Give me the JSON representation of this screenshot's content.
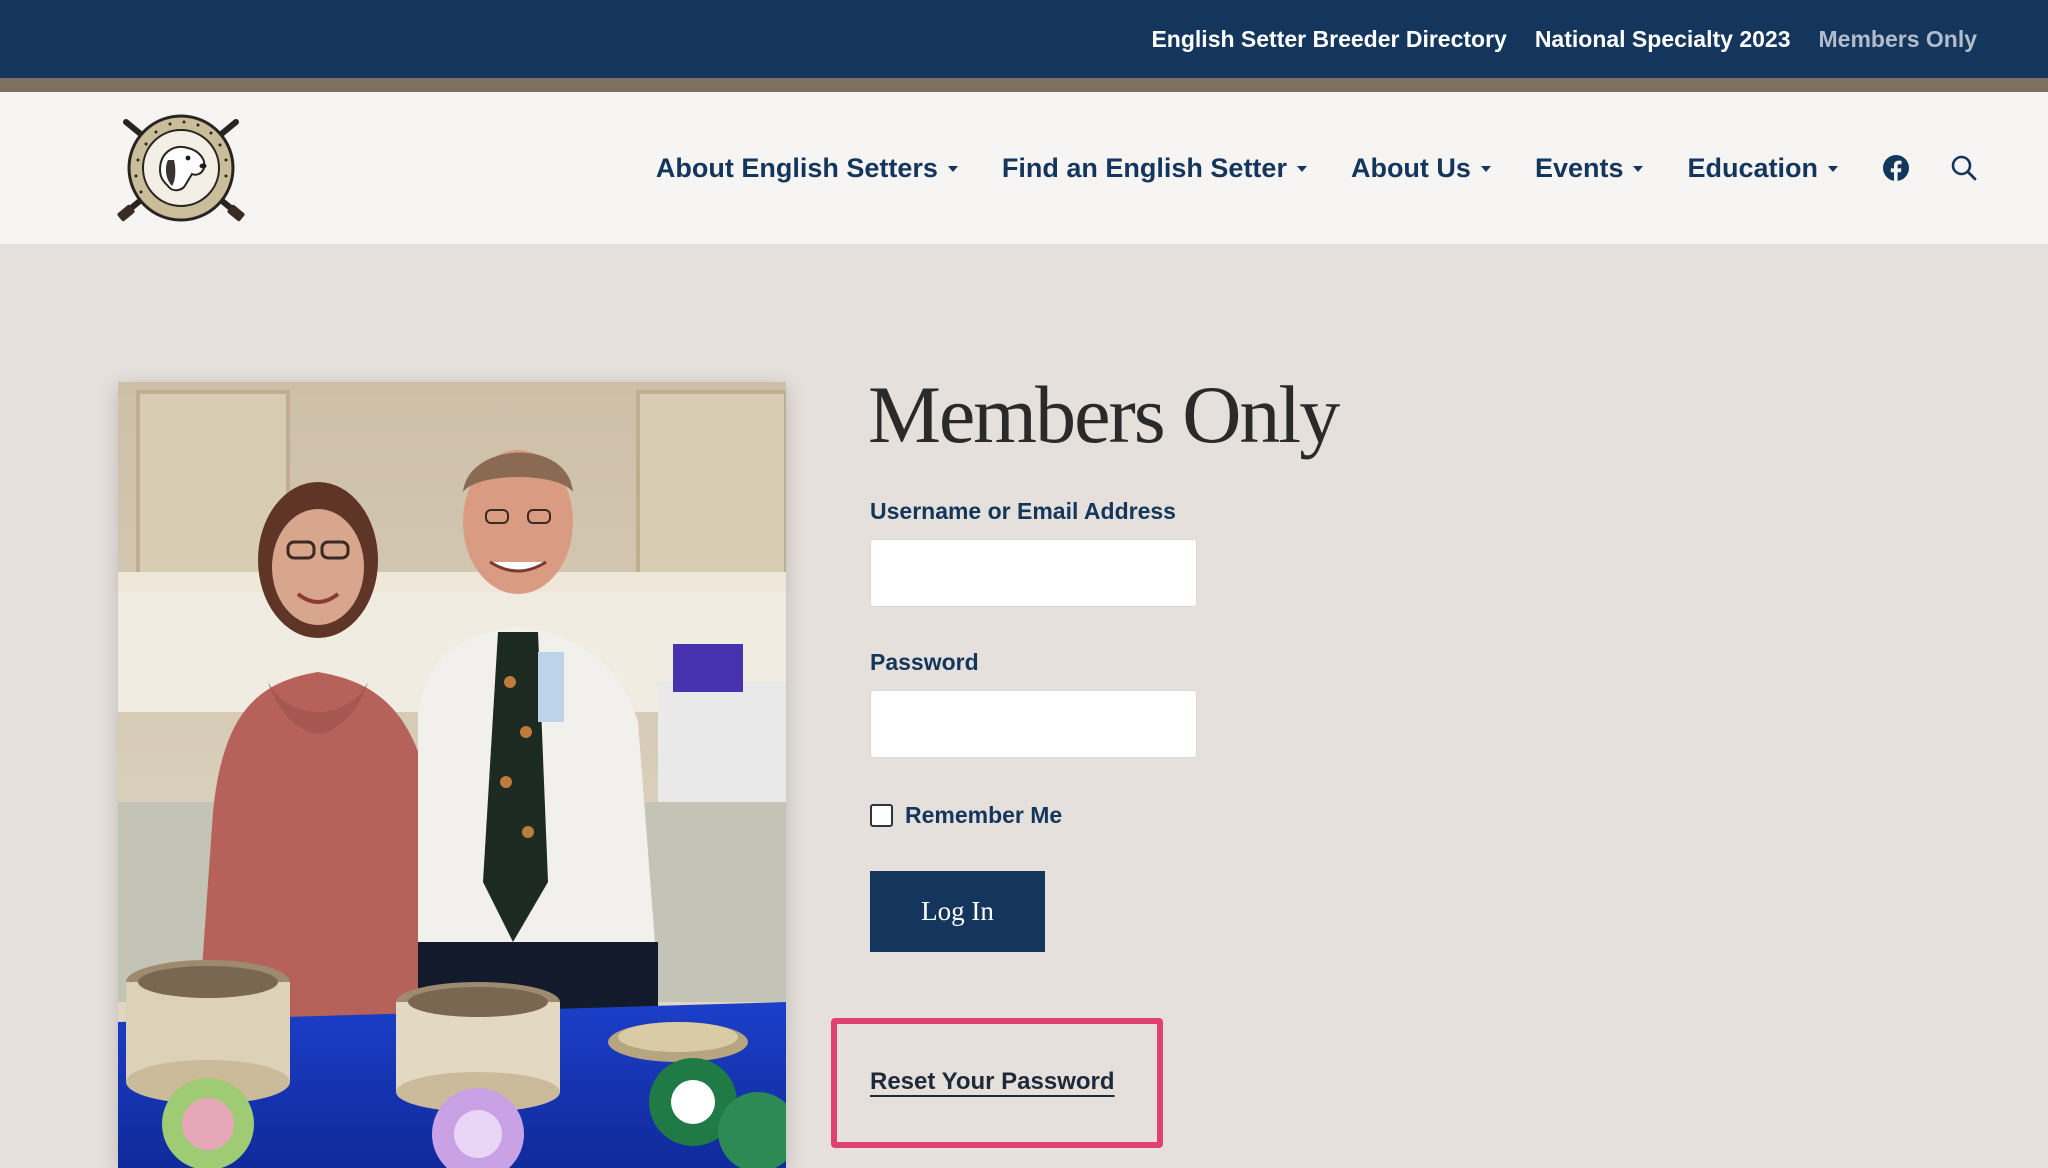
{
  "topbar": {
    "links": [
      "English Setter Breeder Directory",
      "National Specialty 2023",
      "Members Only"
    ]
  },
  "header": {
    "logo_text": "ENGLISH SETTER ASSOCIATION OF AMERICA",
    "nav": [
      "About English Setters",
      "Find an English Setter",
      "About Us",
      "Events",
      "Education"
    ],
    "icons": [
      "facebook-icon",
      "search-icon"
    ]
  },
  "main": {
    "title": "Members Only",
    "username_label": "Username or Email Address",
    "username_value": "",
    "password_label": "Password",
    "password_value": "",
    "remember_label": "Remember Me",
    "remember_checked": false,
    "login_label": "Log In",
    "reset_label": "Reset Your Password"
  },
  "colors": {
    "navy": "#14365c",
    "stripe": "#7d7061",
    "header_bg": "#f6f5f3",
    "page_bg": "#e5e0db",
    "highlight": "#e0426f"
  }
}
